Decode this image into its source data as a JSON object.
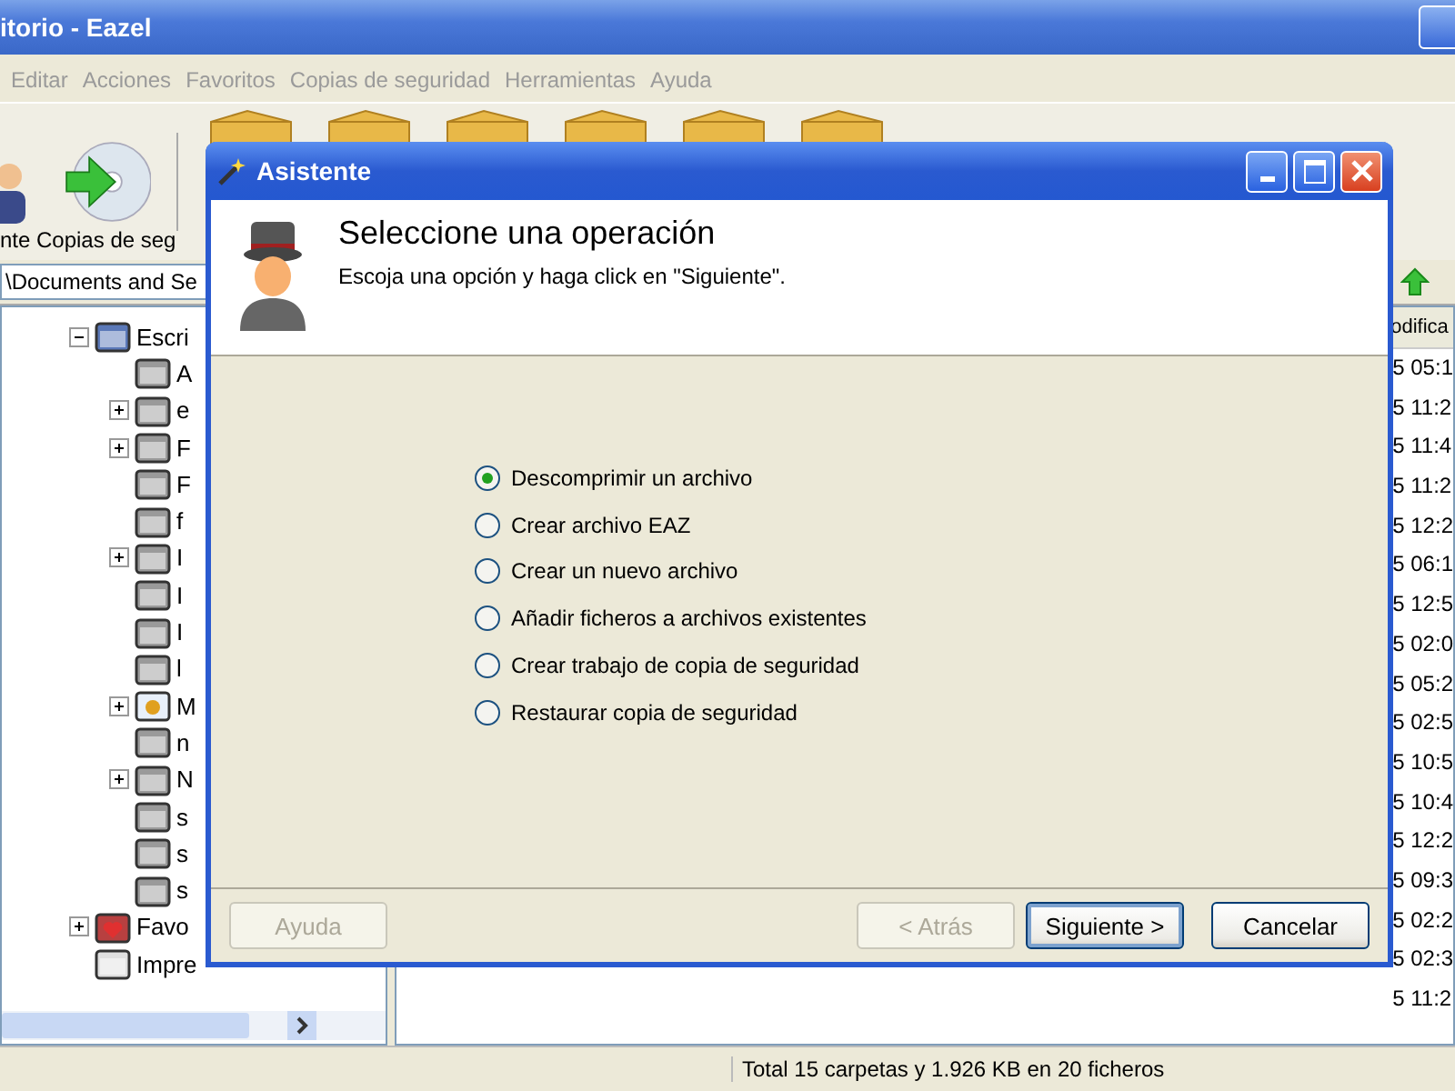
{
  "window": {
    "title": "itorio - Eazel"
  },
  "menu": [
    "Editar",
    "Acciones",
    "Favoritos",
    "Copias de seguridad",
    "Herramientas",
    "Ayuda"
  ],
  "toolbar": [
    {
      "label": "nte",
      "kind": "user"
    },
    {
      "label": "Copias de seg",
      "kind": "backup"
    }
  ],
  "address": {
    "value": "\\Documents and Se"
  },
  "tree": [
    {
      "label": "Escri",
      "kind": "desktop",
      "expandable": true,
      "expanded": true,
      "children": [
        {
          "label": "A",
          "kind": "folder",
          "expandable": false,
          "expanded": false
        },
        {
          "label": "e",
          "kind": "folder",
          "expandable": true,
          "expanded": false
        },
        {
          "label": "F",
          "kind": "folder",
          "expandable": true,
          "expanded": false
        },
        {
          "label": "F",
          "kind": "folder",
          "expandable": false,
          "expanded": false
        },
        {
          "label": "f",
          "kind": "folder",
          "expandable": false,
          "expanded": false
        },
        {
          "label": "I",
          "kind": "folder",
          "expandable": true,
          "expanded": false
        },
        {
          "label": "I",
          "kind": "folder",
          "expandable": false,
          "expanded": false
        },
        {
          "label": "I",
          "kind": "folder",
          "expandable": false,
          "expanded": false
        },
        {
          "label": "l",
          "kind": "folder",
          "expandable": false,
          "expanded": false
        },
        {
          "label": "M",
          "kind": "special",
          "expandable": true,
          "expanded": false
        },
        {
          "label": "n",
          "kind": "folder",
          "expandable": false,
          "expanded": false
        },
        {
          "label": "N",
          "kind": "folder",
          "expandable": true,
          "expanded": false
        },
        {
          "label": "s",
          "kind": "folder",
          "expandable": false,
          "expanded": false
        },
        {
          "label": "s",
          "kind": "folder",
          "expandable": false,
          "expanded": false
        },
        {
          "label": "s",
          "kind": "folder",
          "expandable": false,
          "expanded": false
        }
      ]
    },
    {
      "label": "Favo",
      "kind": "favorites",
      "expandable": true,
      "expanded": false
    },
    {
      "label": "Impre",
      "kind": "printer",
      "expandable": false,
      "expanded": false
    }
  ],
  "list": {
    "column_header": "odifica",
    "rows": [
      "5 05:1",
      "5 11:2",
      "5 11:4",
      "5 11:2",
      "5 12:2",
      "5 06:1",
      "5 12:5",
      "5 02:0",
      "5 05:2",
      "5 02:5",
      "5 10:5",
      "5 10:4",
      "5 12:2",
      "5 09:3",
      "5 02:2",
      "5 02:3",
      "5 11:2"
    ]
  },
  "dialog": {
    "title": "Asistente",
    "heading": "Seleccione una operación",
    "subheading": "Escoja una opción y haga click en \"Siguiente\".",
    "options": [
      {
        "label": "Descomprimir un archivo",
        "selected": true
      },
      {
        "label": "Crear archivo EAZ",
        "selected": false
      },
      {
        "label": "Crear un nuevo archivo",
        "selected": false
      },
      {
        "label": "Añadir ficheros a archivos existentes",
        "selected": false
      },
      {
        "label": "Crear trabajo de copia de seguridad",
        "selected": false
      },
      {
        "label": "Restaurar copia de seguridad",
        "selected": false
      }
    ],
    "buttons": [
      {
        "label": "Ayuda",
        "disabled": true,
        "default": false
      },
      {
        "label": "< Atrás",
        "disabled": true,
        "default": false
      },
      {
        "label": "Siguiente >",
        "disabled": false,
        "default": true
      },
      {
        "label": "Cancelar",
        "disabled": false,
        "default": false
      }
    ]
  },
  "status_bar": "Total 15 carpetas y 1.926 KB en 20 ficheros"
}
